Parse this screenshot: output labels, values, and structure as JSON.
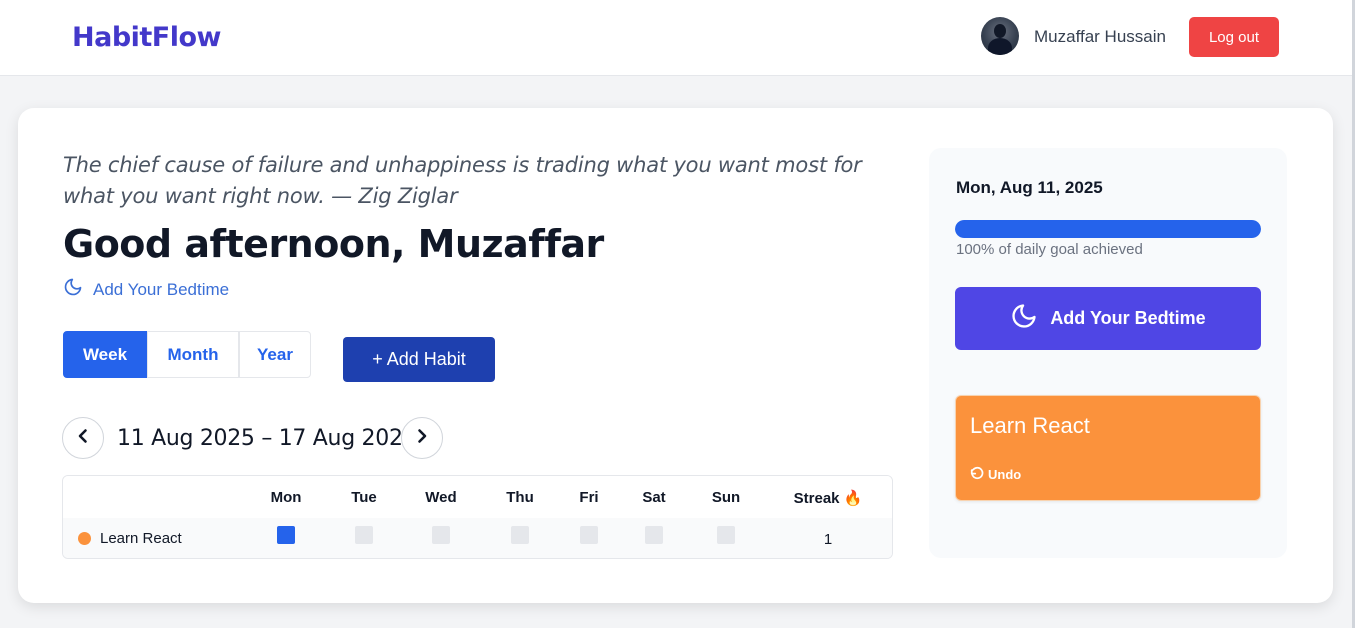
{
  "header": {
    "brand": "HabitFlow",
    "user_name": "Muzaffar Hussain",
    "logout_label": "Log out"
  },
  "main": {
    "quote": "The chief cause of failure and unhappiness is trading what you want most for what you want right now. — Zig Ziglar",
    "greeting": "Good afternoon, Muzaffar",
    "bedtime_link": "Add Your Bedtime",
    "tabs": [
      {
        "label": "Week",
        "active": true
      },
      {
        "label": "Month",
        "active": false
      },
      {
        "label": "Year",
        "active": false
      }
    ],
    "add_habit_label": "+ Add Habit",
    "date_range": "11 Aug 2025 – 17 Aug 2025"
  },
  "table": {
    "headers": [
      "Mon",
      "Tue",
      "Wed",
      "Thu",
      "Fri",
      "Sat",
      "Sun",
      "Streak 🔥"
    ],
    "rows": [
      {
        "name": "Learn React",
        "color": "#fb923c",
        "days": [
          true,
          false,
          false,
          false,
          false,
          false,
          false
        ],
        "streak": "1"
      }
    ]
  },
  "sidebar": {
    "date": "Mon, Aug 11, 2025",
    "progress_percent": 100,
    "progress_text": "100% of daily goal achieved",
    "bedtime_button": "Add Your Bedtime",
    "habit_card": {
      "title": "Learn React",
      "undo_label": "Undo",
      "color": "#fb923c"
    }
  },
  "colors": {
    "brand": "#4338ca",
    "primary": "#2563eb",
    "danger": "#ef4444",
    "indigo": "#4f46e5"
  }
}
